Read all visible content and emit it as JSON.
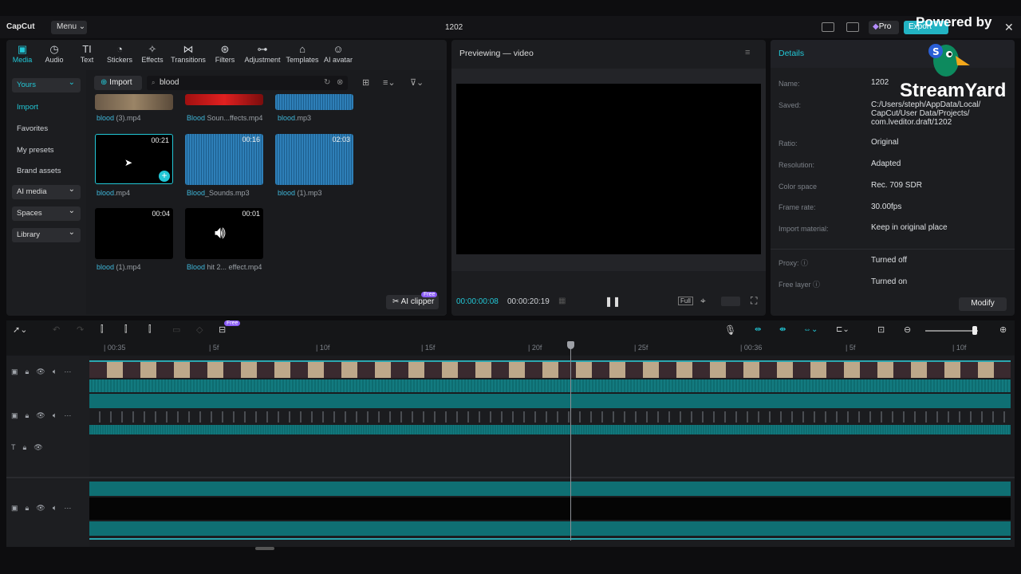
{
  "app": {
    "logo": "CapCut",
    "menu_label": "Menu ⌄",
    "window_title": "1202",
    "pro_label": "Pro",
    "export_label": "Export"
  },
  "toolbar": [
    {
      "label": "Media",
      "icon": "media-icon"
    },
    {
      "label": "Audio",
      "icon": "audio-icon"
    },
    {
      "label": "Text",
      "icon": "text-icon"
    },
    {
      "label": "Stickers",
      "icon": "sticker-icon"
    },
    {
      "label": "Effects",
      "icon": "effects-icon"
    },
    {
      "label": "Transitions",
      "icon": "transitions-icon"
    },
    {
      "label": "Filters",
      "icon": "filters-icon"
    },
    {
      "label": "Adjustment",
      "icon": "adjustment-icon"
    },
    {
      "label": "Templates",
      "icon": "templates-icon"
    },
    {
      "label": "AI avatar",
      "icon": "ai-avatar-icon"
    }
  ],
  "sidebar": {
    "yours": "Yours",
    "import": "Import",
    "favorites": "Favorites",
    "presets": "My presets",
    "brand": "Brand assets",
    "ai_media": "AI media",
    "spaces": "Spaces",
    "library": "Library"
  },
  "media": {
    "import_label": "Import",
    "search_value": "blood",
    "row1": [
      {
        "hl": "blood",
        "rest": " (3).mp4"
      },
      {
        "hl": "Blood",
        "rest": " Soun...ffects.mp4"
      },
      {
        "hl": "blood",
        "rest": ".mp3"
      }
    ],
    "row2": [
      {
        "hl": "blood",
        "rest": ".mp4",
        "dur": "00:21"
      },
      {
        "hl": "Blood",
        "rest": "_Sounds.mp3",
        "dur": "00:16"
      },
      {
        "hl": "blood",
        "rest": " (1).mp3",
        "dur": "02:03"
      }
    ],
    "row3": [
      {
        "hl": "blood",
        "rest": " (1).mp4",
        "dur": "00:04"
      },
      {
        "hl": "Blood",
        "rest": " hit 2... effect.mp4",
        "dur": "00:01"
      }
    ],
    "ai_clipper": "AI clipper",
    "free": "Free"
  },
  "preview": {
    "title": "Previewing — video",
    "current_time": "00:00:00:08",
    "total_time": "00:00:20:19",
    "full_label": "Full"
  },
  "details": {
    "title": "Details",
    "rows": [
      {
        "k": "Name:",
        "v": "1202"
      },
      {
        "k": "Saved:",
        "v": "C:/Users/steph/AppData/Local/ CapCut/User Data/Projects/ com.lveditor.draft/1202"
      },
      {
        "k": "Ratio:",
        "v": "Original"
      },
      {
        "k": "Resolution:",
        "v": "Adapted"
      },
      {
        "k": "Color space",
        "v": "Rec. 709 SDR"
      },
      {
        "k": "Frame rate:",
        "v": "30.00fps"
      },
      {
        "k": "Import material:",
        "v": "Keep in original place"
      },
      {
        "k": "Proxy: ⓘ",
        "v": "Turned off"
      },
      {
        "k": "Free layer ⓘ",
        "v": "Turned on"
      }
    ],
    "modify": "Modify"
  },
  "timeline": {
    "ruler": [
      "| 00:35",
      "| 5f",
      "| 10f",
      "| 15f",
      "| 20f",
      "| 25f",
      "| 00:36",
      "| 5f",
      "| 10f"
    ],
    "free": "Free"
  },
  "watermark": {
    "powered": "Powered by",
    "brand": "StreamYard"
  },
  "colors": {
    "accent": "#22c7d6",
    "teal_clip": "#0f6f73",
    "panel": "#1c1d20"
  }
}
